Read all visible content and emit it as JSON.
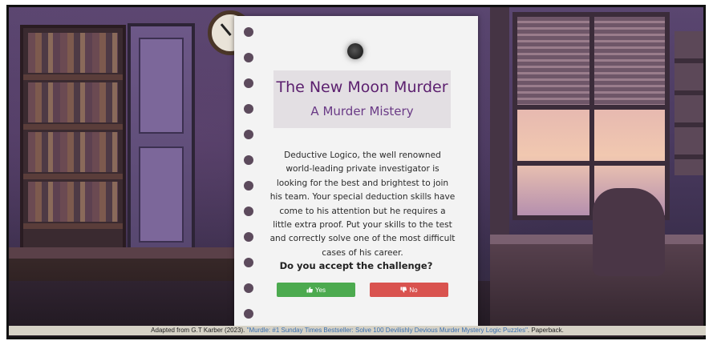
{
  "story": {
    "title": "The New Moon Murder",
    "subtitle": "A Murder Mistery",
    "description": "Deductive Logico, the well renowned world-leading private investigator is looking for the best and brightest to join his team. Your special deduction skills have come to his attention but he requires a little extra proof. Put your skills to the test and correctly solve one of the most difficult cases of his career.",
    "question": "Do you accept the challenge?"
  },
  "buttons": {
    "yes_label": "Yes",
    "yes_icon": "thumbs-up-icon",
    "no_label": "No",
    "no_icon": "thumbs-down-icon"
  },
  "colors": {
    "title": "#5b1f6e",
    "yes": "#4caa4f",
    "no": "#d9534f",
    "page": "#f3f3f3"
  },
  "footer": {
    "prefix": "Adapted from G.T Karber (2023).",
    "link_text": "\"Murdle: #1 Sunday Times Bestseller: Solve 100 Devilishly Devious Murder Mystery Logic Puzzles\"",
    "suffix": ". Paperback."
  }
}
